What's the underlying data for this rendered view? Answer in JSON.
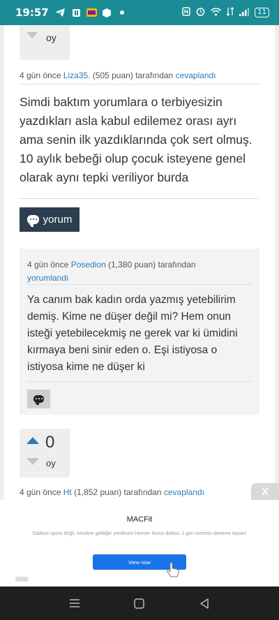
{
  "status_bar": {
    "time": "19:57",
    "battery": "11",
    "left_icons": [
      "telegram-icon",
      "notification-icon",
      "app-icon",
      "cube-icon",
      "dot-icon"
    ],
    "right_icons": [
      "nfc-icon",
      "alarm-icon",
      "wifi-icon",
      "data-icon",
      "signal-icon"
    ]
  },
  "answer1": {
    "vote_unit": "oy",
    "meta": {
      "prefix": "4 gün önce",
      "author": "Liza35.",
      "points": "(505 puan)",
      "by": "tarafından",
      "action": "cevaplandı"
    },
    "text": "Simdi baktım yorumlara o terbiyesizin yazdıkları asla kabul edilemez orası ayrı ama senin ilk yazdıklarında çok sert olmuş. 10 aylık bebeği olup çocuk isteyene genel olarak aynı tepki veriliyor burda",
    "comment_button_label": "yorum"
  },
  "comment": {
    "meta": {
      "prefix": "4 gün önce",
      "author": "Posedion",
      "points": "(1,380 puan)",
      "by": "tarafından",
      "action": "yorumlandı"
    },
    "text": "Ya canım bak kadın orda yazmış yetebilirim demiş. Kime ne düşer değil mi? Hem onun isteği yetebilecekmiş ne gerek var ki ümidini kırmaya beni sinir eden o. Eşi istiyosa o istiyosa kime ne düşer ki"
  },
  "answer2": {
    "vote_count": "0",
    "vote_unit": "oy",
    "meta": {
      "prefix": "4 gün önce",
      "author": "Ht",
      "points": "(1,852 puan)",
      "by": "tarafından",
      "action": "cevaplandı"
    }
  },
  "ad": {
    "close_label": "X",
    "title": "MACFit",
    "description": "Sadece spora değil, kendine geldiğin yerdesin! Hemen formu doldur, 1 gün ücretsiz deneme kazan!",
    "cta_label": "View now"
  },
  "colors": {
    "status_bar": "#1b8c96",
    "link": "#2b7bb9",
    "comment_button": "#2c3e50",
    "ad_cta": "#1a73e8"
  }
}
